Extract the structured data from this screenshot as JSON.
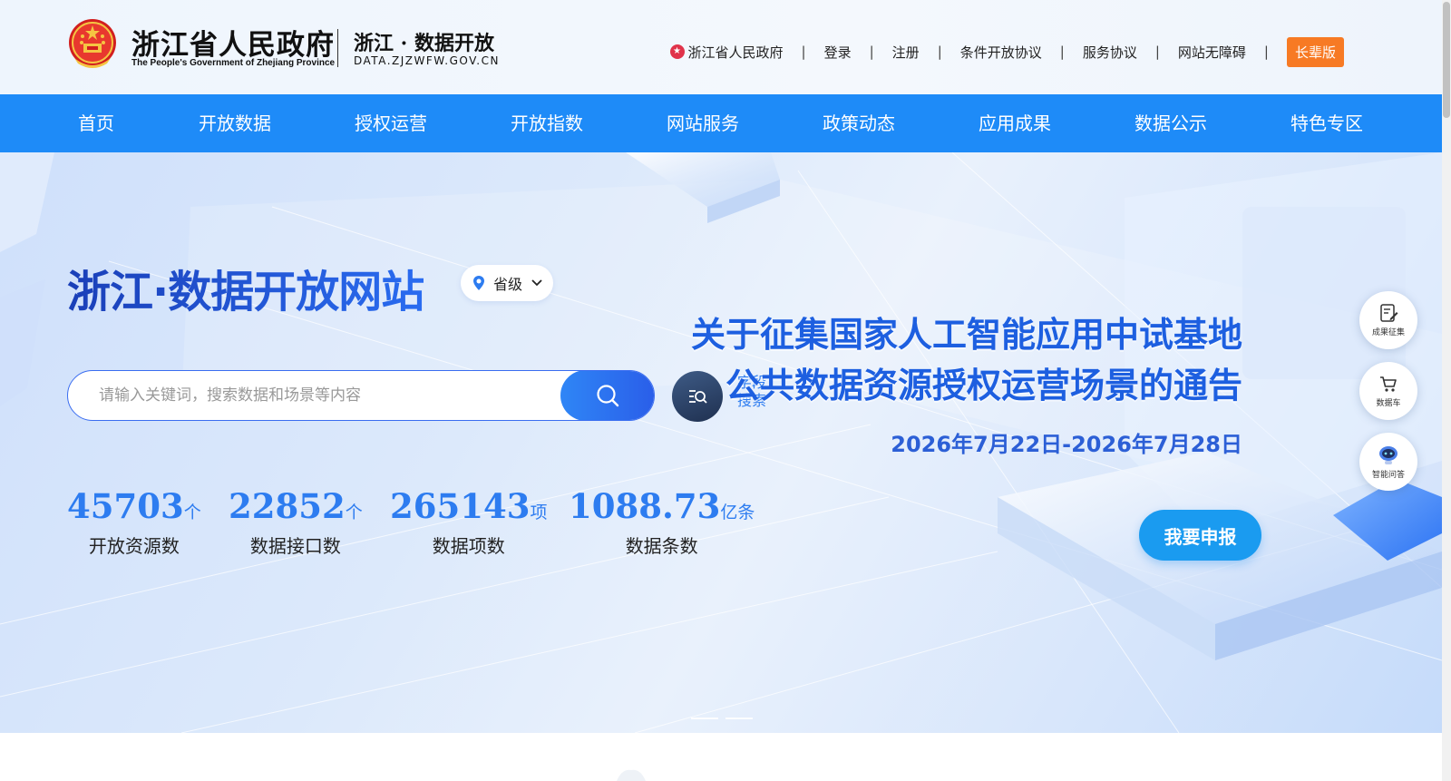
{
  "header": {
    "gov_title": "浙江省人民政府",
    "gov_subtitle": "The People's Government of Zhejiang Province",
    "site_title": "浙江 · 数据开放",
    "site_domain": "DATA.ZJZWFW.GOV.CN",
    "links": {
      "provincial_gov": "浙江省人民政府",
      "login": "登录",
      "register": "注册",
      "conditional_agreement": "条件开放协议",
      "service_agreement": "服务协议",
      "accessibility": "网站无障碍",
      "elder_mode": "长辈版"
    },
    "separator": "|"
  },
  "nav": {
    "items": [
      "首页",
      "开放数据",
      "授权运营",
      "开放指数",
      "网站服务",
      "政策动态",
      "应用成果",
      "数据公示",
      "特色专区"
    ]
  },
  "hero": {
    "title": "浙江·数据开放网站",
    "level": "省级",
    "search_placeholder": "请输入关键词，搜索数据和场景等内容",
    "field_search_label_line1": "字段",
    "field_search_label_line2": "搜索"
  },
  "stats": [
    {
      "value": "45703",
      "unit": "个",
      "label": "开放资源数"
    },
    {
      "value": "22852",
      "unit": "个",
      "label": "数据接口数"
    },
    {
      "value": "265143",
      "unit": "项",
      "label": "数据项数"
    },
    {
      "value": "1088.73",
      "unit": "亿条",
      "label": "数据条数"
    }
  ],
  "notice": {
    "line1": "关于征集国家人工智能应用中试基地",
    "line2": "公共数据资源授权运营场景的通告",
    "date": "2026年7月22日-2026年7月28日",
    "apply_label": "我要申报"
  },
  "side_buttons": {
    "achievements": "成果征集",
    "data_cart": "数据车",
    "ai_qa": "智能问答"
  },
  "colors": {
    "nav_blue": "#1e8bf8",
    "accent_blue": "#2d7cf0",
    "elder_orange": "#f77a24"
  }
}
